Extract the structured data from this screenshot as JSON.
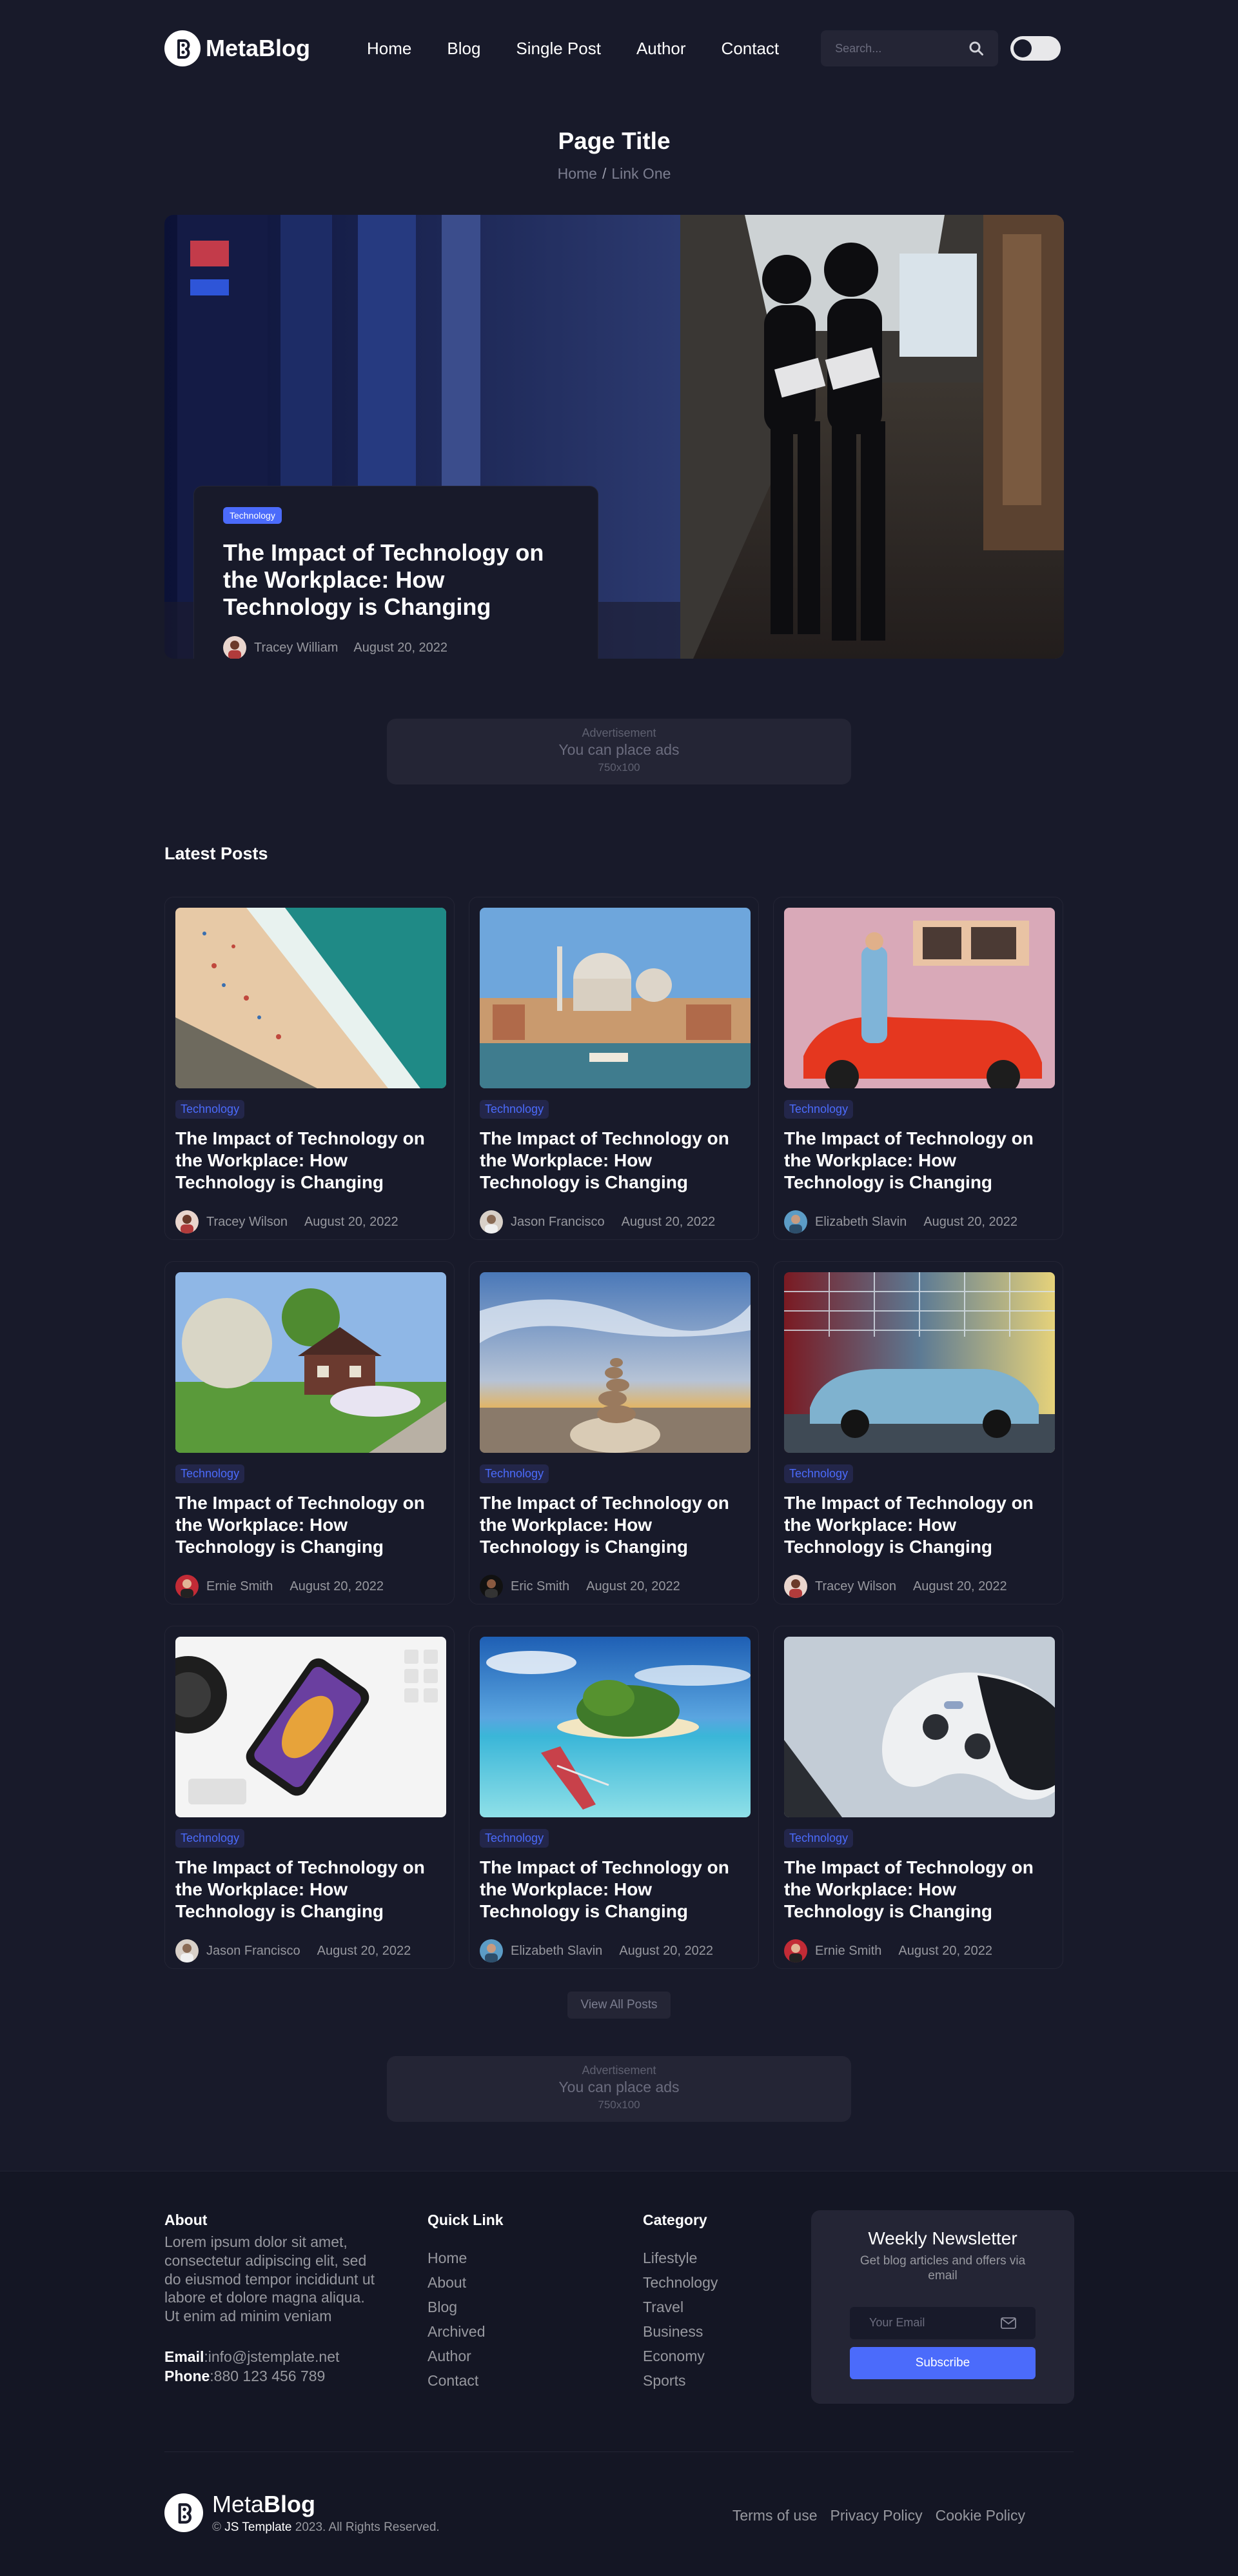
{
  "header": {
    "brand": "MetaBlog",
    "nav": [
      "Home",
      "Blog",
      "Single Post",
      "Author",
      "Contact"
    ],
    "search_placeholder": "Search...",
    "icons": {
      "search": "search-icon",
      "toggle": "theme-toggle"
    }
  },
  "page": {
    "title": "Page Title",
    "breadcrumb": [
      "Home",
      "Link One"
    ],
    "breadcrumb_sep": "/"
  },
  "hero": {
    "category": "Technology",
    "title": "The Impact of Technology on the Workplace: How Technology is Changing",
    "author": "Tracey William",
    "date": "August 20, 2022"
  },
  "ad": {
    "label": "Advertisement",
    "text": "You can place ads",
    "size": "750x100"
  },
  "latest": {
    "heading": "Latest Posts",
    "posts": [
      {
        "category": "Technology",
        "title": "The Impact of Technology on the Workplace: How Technology is Changing",
        "author": "Tracey Wilson",
        "date": "August 20, 2022"
      },
      {
        "category": "Technology",
        "title": "The Impact of Technology on the Workplace: How Technology is Changing",
        "author": "Jason Francisco",
        "date": "August 20, 2022"
      },
      {
        "category": "Technology",
        "title": "The Impact of Technology on the Workplace: How Technology is Changing",
        "author": "Elizabeth Slavin",
        "date": "August 20, 2022"
      },
      {
        "category": "Technology",
        "title": "The Impact of Technology on the Workplace: How Technology is Changing",
        "author": "Ernie Smith",
        "date": "August 20, 2022"
      },
      {
        "category": "Technology",
        "title": "The Impact of Technology on the Workplace: How Technology is Changing",
        "author": "Eric Smith",
        "date": "August 20, 2022"
      },
      {
        "category": "Technology",
        "title": "The Impact of Technology on the Workplace: How Technology is Changing",
        "author": "Tracey Wilson",
        "date": "August 20, 2022"
      },
      {
        "category": "Technology",
        "title": "The Impact of Technology on the Workplace: How Technology is Changing",
        "author": "Jason Francisco",
        "date": "August 20, 2022"
      },
      {
        "category": "Technology",
        "title": "The Impact of Technology on the Workplace: How Technology is Changing",
        "author": "Elizabeth Slavin",
        "date": "August 20, 2022"
      },
      {
        "category": "Technology",
        "title": "The Impact of Technology on the Workplace: How Technology is Changing",
        "author": "Ernie Smith",
        "date": "August 20, 2022"
      }
    ],
    "view_all": "View All Posts"
  },
  "footer": {
    "about": {
      "heading": "About",
      "text": "Lorem ipsum dolor sit amet, consectetur adipiscing elit, sed do eiusmod tempor incididunt ut labore et dolore magna aliqua. Ut enim ad minim veniam",
      "email_label": "Email",
      "email": ":info@jstemplate.net",
      "phone_label": "Phone",
      "phone": ":880 123 456 789"
    },
    "quick_links": {
      "heading": "Quick Link",
      "items": [
        "Home",
        "About",
        "Blog",
        "Archived",
        "Author",
        "Contact"
      ]
    },
    "categories": {
      "heading": "Category",
      "items": [
        "Lifestyle",
        "Technology",
        "Travel",
        "Business",
        "Economy",
        "Sports"
      ]
    },
    "newsletter": {
      "title": "Weekly Newsletter",
      "subtitle": "Get blog articles and offers via email",
      "placeholder": "Your Email",
      "button": "Subscribe"
    },
    "brand_light": "Meta",
    "brand_bold": "Blog",
    "copyright_prefix": "© ",
    "copyright_brand": "JS Template",
    "copyright_rest": " 2023. All Rights Reserved.",
    "legal_links": [
      "Terms of use",
      "Privacy Policy",
      "Cookie Policy"
    ]
  },
  "colors": {
    "background": "#181a2a",
    "surface": "#242535",
    "accent": "#4b6bfb",
    "muted": "#97989f"
  }
}
